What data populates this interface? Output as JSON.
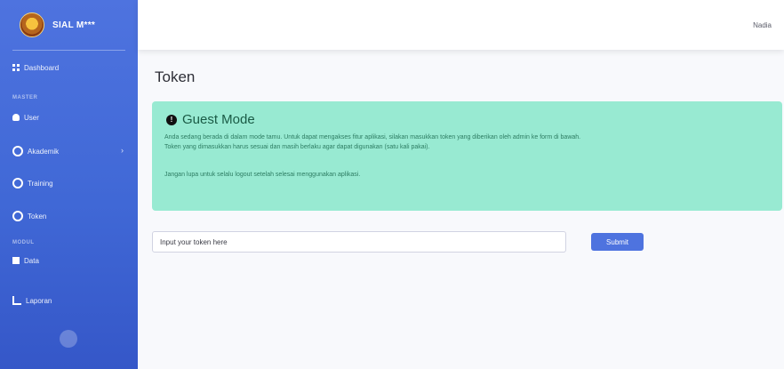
{
  "app": {
    "brand": "SIAL M***"
  },
  "sidebar": {
    "items": [
      {
        "label": "Dashboard",
        "icon": "grid-icon"
      },
      {
        "label": "User",
        "icon": "user-icon"
      },
      {
        "label": "Akademik",
        "icon": "gear-icon"
      },
      {
        "label": "Training",
        "icon": "settings-icon"
      },
      {
        "label": "Token",
        "icon": "key-icon"
      },
      {
        "label": "Data",
        "icon": "doc-icon"
      },
      {
        "label": "Laporan",
        "icon": "chart-icon"
      }
    ],
    "sections": [
      "MASTER",
      "MODUL"
    ]
  },
  "topbar": {
    "user": "Nadia"
  },
  "main": {
    "title": "Token",
    "alert": {
      "title": "Guest Mode",
      "text1": "Anda sedang berada di dalam mode tamu. Untuk dapat mengakses fitur aplikasi, silakan masukkan token yang diberikan oleh admin ke form di bawah.",
      "text2": "Token yang dimasukkan harus sesuai dan masih berlaku agar dapat digunakan (satu kali pakai).",
      "note": "Jangan lupa untuk selalu logout setelah selesai menggunakan aplikasi."
    },
    "token": {
      "placeholder": "Input your token here",
      "submit": "Submit"
    }
  },
  "colors": {
    "accent": "#4e73df",
    "alert_bg": "#98ead2"
  }
}
